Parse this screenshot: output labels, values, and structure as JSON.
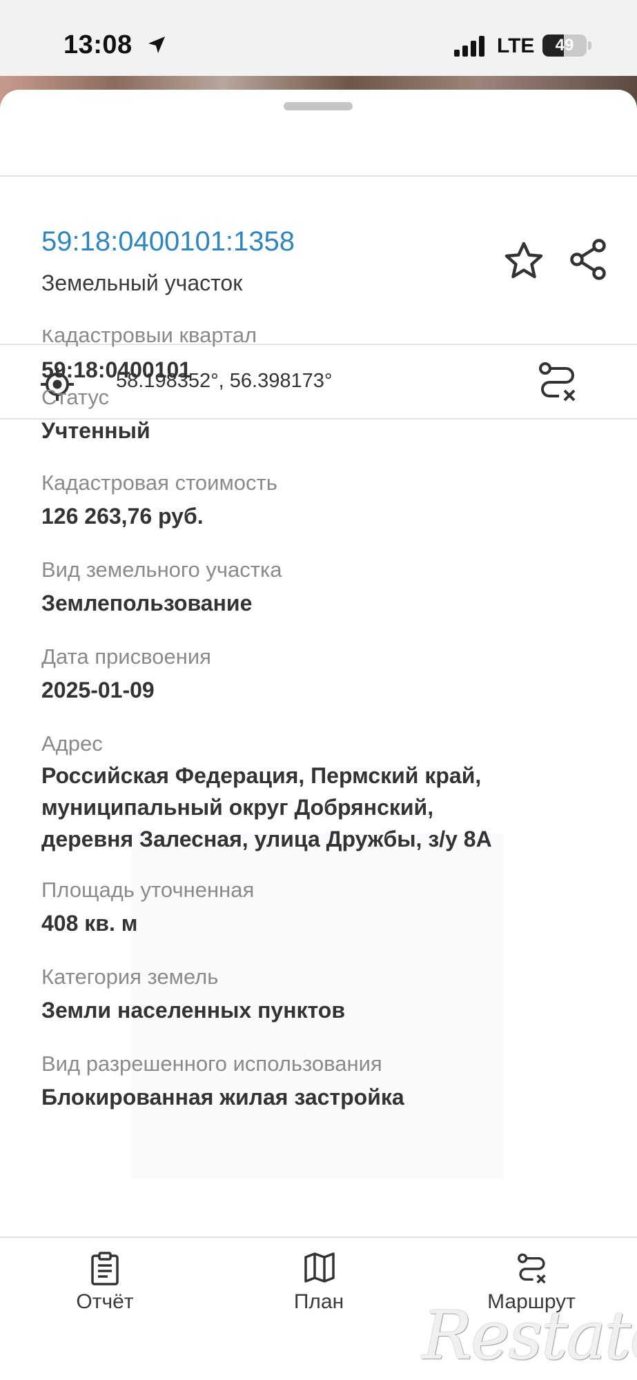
{
  "status_bar": {
    "time": "13:08",
    "network": "LTE",
    "battery": "49",
    "battery_level": 0.49
  },
  "header": {
    "cadastral_number": "59:18:0400101:1358",
    "object_type": "Земельный участок",
    "favorite_icon": "star-icon",
    "share_icon": "share-icon"
  },
  "location": {
    "coordinates": "58.198352°, 56.398173°",
    "target_icon": "crosshair-icon",
    "route_icon": "route-icon"
  },
  "details": [
    {
      "label": "Кадастровый квартал",
      "value": "59:18:0400101"
    },
    {
      "label": "Статус",
      "value": "Учтенный"
    },
    {
      "label": "Кадастровая стоимость",
      "value": "126 263,76 руб."
    },
    {
      "label": "Вид земельного участка",
      "value": "Землепользование"
    },
    {
      "label": "Дата присвоения",
      "value": "2025-01-09"
    },
    {
      "label": "Адрес",
      "value_lines": [
        "Российская Федерация, Пермский край,",
        "муниципальный округ Добрянский,",
        "деревня Залесная, улица Дружбы, з/у 8А"
      ]
    },
    {
      "label": "Площадь уточненная",
      "value": "408 кв. м"
    },
    {
      "label": "Категория земель",
      "value": "Земли населенных пунктов"
    },
    {
      "label": "Вид разрешенного использования",
      "value": "Блокированная жилая застройка"
    }
  ],
  "tabbar": {
    "items": [
      {
        "label": "Отчёт",
        "icon": "clipboard-icon"
      },
      {
        "label": "План",
        "icon": "map-icon"
      },
      {
        "label": "Маршрут",
        "icon": "route-icon"
      }
    ]
  },
  "watermark": {
    "text": "Restate"
  }
}
